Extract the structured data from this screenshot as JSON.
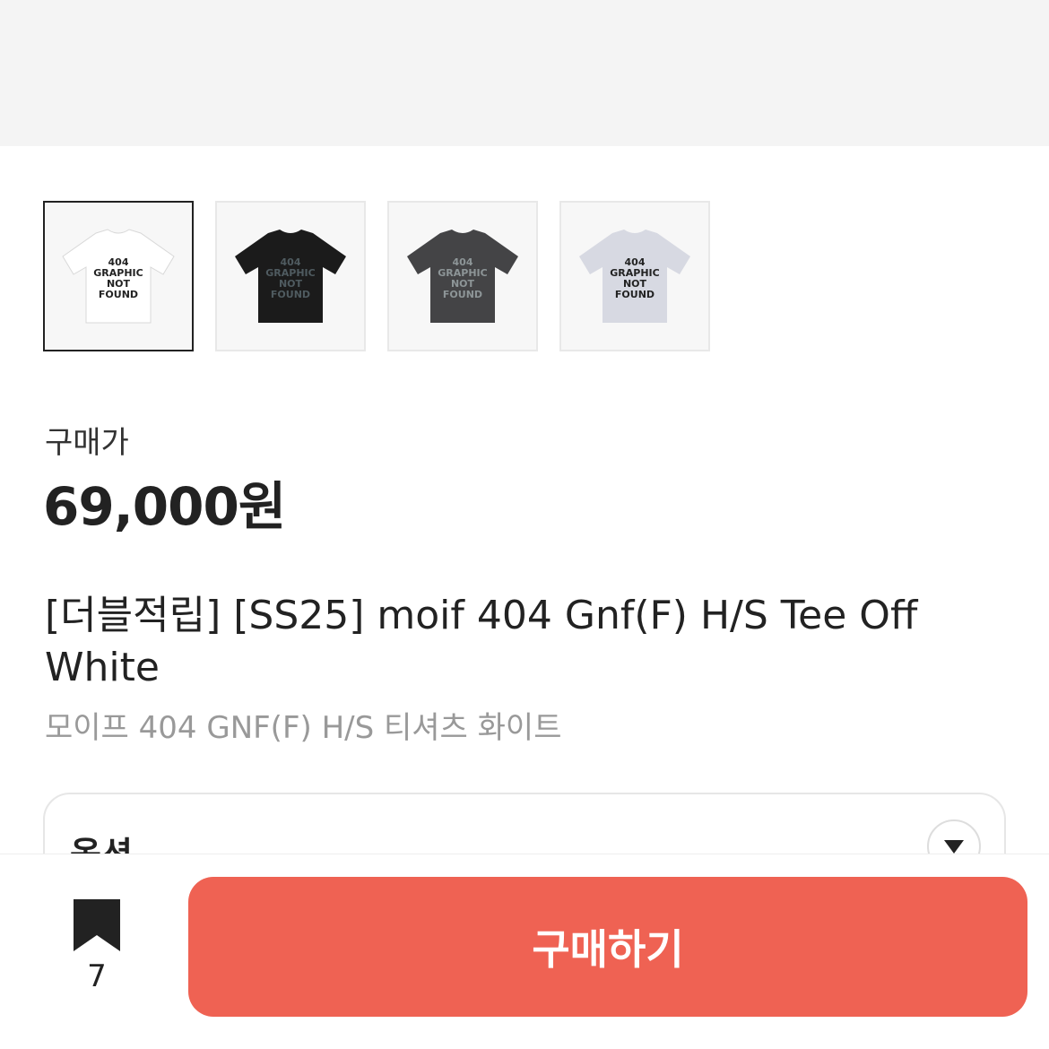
{
  "colors": {
    "accent": "#ef6253",
    "text": "#222222",
    "muted": "#999999",
    "banner": "#f4f4f4"
  },
  "thumbnails": [
    {
      "shirt_color": "#ffffff",
      "print_color": "#222222",
      "print_text": [
        "404",
        "GRAPHIC",
        "NOT",
        "FOUND"
      ],
      "selected": true
    },
    {
      "shirt_color": "#1b1b1b",
      "print_color": "#4f5b60",
      "print_text": [
        "404",
        "GRAPHIC",
        "NOT",
        "FOUND"
      ],
      "selected": false
    },
    {
      "shirt_color": "#444446",
      "print_color": "#8d9597",
      "print_text": [
        "404",
        "GRAPHIC",
        "NOT",
        "FOUND"
      ],
      "selected": false
    },
    {
      "shirt_color": "#d7d9e2",
      "print_color": "#222222",
      "print_text": [
        "404",
        "GRAPHIC",
        "NOT",
        "FOUND"
      ],
      "selected": false
    }
  ],
  "price": {
    "label": "구매가",
    "value": "69,000원"
  },
  "product": {
    "title": "[더블적립] [SS25] moif 404 Gnf(F) H/S Tee Off White",
    "subtitle": "모이프 404 GNF(F) H/S 티셔츠 화이트"
  },
  "option": {
    "label": "옵션",
    "icon": "chevron-down-icon"
  },
  "bottom_bar": {
    "bookmark_icon": "bookmark-icon",
    "bookmark_count": "7",
    "buy_label": "구매하기"
  }
}
